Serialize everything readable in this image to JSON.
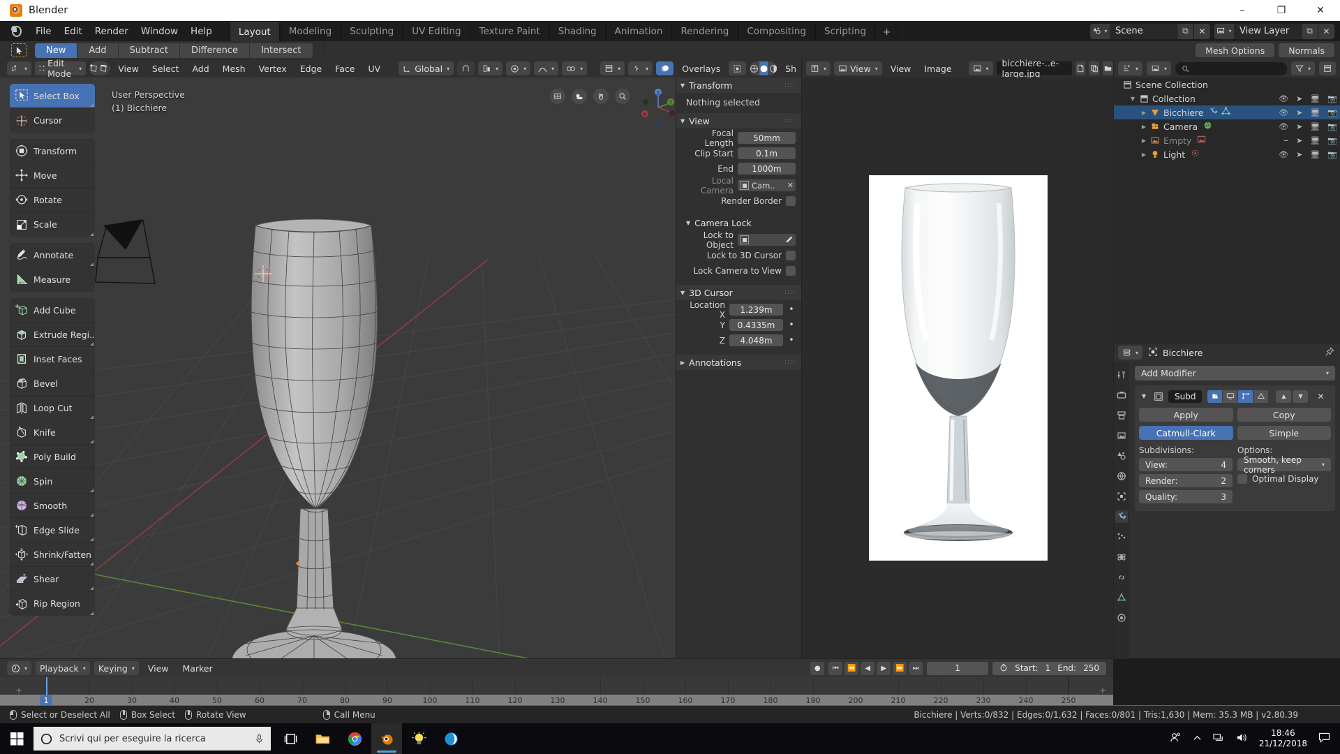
{
  "window": {
    "title": "Blender",
    "controls": {
      "minimize": "–",
      "maximize": "❐",
      "close": "✕"
    }
  },
  "topbar": {
    "menus": [
      "File",
      "Edit",
      "Render",
      "Window",
      "Help"
    ],
    "workspaces": [
      {
        "label": "Layout",
        "active": true
      },
      {
        "label": "Modeling",
        "active": false
      },
      {
        "label": "Sculpting",
        "active": false
      },
      {
        "label": "UV Editing",
        "active": false
      },
      {
        "label": "Texture Paint",
        "active": false
      },
      {
        "label": "Shading",
        "active": false
      },
      {
        "label": "Animation",
        "active": false
      },
      {
        "label": "Rendering",
        "active": false
      },
      {
        "label": "Compositing",
        "active": false
      },
      {
        "label": "Scripting",
        "active": false
      }
    ],
    "add_workspace": "+",
    "scene": {
      "name": "Scene",
      "new_btn": "⧉",
      "unlink_btn": "✕"
    },
    "view_layer": {
      "name": "View Layer",
      "new_btn": "⧉",
      "unlink_btn": "✕"
    }
  },
  "tool_settings": {
    "boolean_modes": [
      {
        "label": "New",
        "active": true
      },
      {
        "label": "Add",
        "active": false
      },
      {
        "label": "Subtract",
        "active": false
      },
      {
        "label": "Difference",
        "active": false
      },
      {
        "label": "Intersect",
        "active": false
      }
    ],
    "right_group": [
      "Mesh Options",
      "Normals"
    ]
  },
  "viewport_header": {
    "mode": "Edit Mode",
    "select_modes": [
      "vertex",
      "edge",
      "face"
    ],
    "active_select_mode": "face",
    "menus": [
      "View",
      "Select",
      "Add",
      "Mesh",
      "Vertex",
      "Edge",
      "Face",
      "UV"
    ],
    "transform_orientation": "Global",
    "overlays_label": "Overlays",
    "shading_label": "Sh",
    "shading_modes": [
      "wireframe",
      "solid",
      "material",
      "rendered"
    ],
    "active_shading": "solid"
  },
  "viewport": {
    "perspective_line1": "User Perspective",
    "perspective_line2": "(1) Bicchiere",
    "tool_groups": [
      [
        {
          "label": "Select Box",
          "icon": "select-box-icon",
          "active": true,
          "has_corner": true
        },
        {
          "label": "Cursor",
          "icon": "cursor-icon",
          "active": false,
          "has_corner": false
        }
      ],
      [
        {
          "label": "Transform",
          "icon": "transform-icon",
          "active": false,
          "has_corner": false
        },
        {
          "label": "Move",
          "icon": "move-icon",
          "active": false,
          "has_corner": false
        },
        {
          "label": "Rotate",
          "icon": "rotate-icon",
          "active": false,
          "has_corner": false
        },
        {
          "label": "Scale",
          "icon": "scale-icon",
          "active": false,
          "has_corner": true
        }
      ],
      [
        {
          "label": "Annotate",
          "icon": "annotate-icon",
          "active": false,
          "has_corner": true
        },
        {
          "label": "Measure",
          "icon": "measure-icon",
          "active": false,
          "has_corner": false
        }
      ],
      [
        {
          "label": "Add Cube",
          "icon": "add-cube-icon",
          "active": false,
          "has_corner": false
        },
        {
          "label": "Extrude Regi..",
          "icon": "extrude-icon",
          "active": false,
          "has_corner": true
        },
        {
          "label": "Inset Faces",
          "icon": "inset-faces-icon",
          "active": false,
          "has_corner": false
        },
        {
          "label": "Bevel",
          "icon": "bevel-icon",
          "active": false,
          "has_corner": false
        },
        {
          "label": "Loop Cut",
          "icon": "loop-cut-icon",
          "active": false,
          "has_corner": true
        },
        {
          "label": "Knife",
          "icon": "knife-icon",
          "active": false,
          "has_corner": true
        },
        {
          "label": "Poly Build",
          "icon": "poly-build-icon",
          "active": false,
          "has_corner": false
        },
        {
          "label": "Spin",
          "icon": "spin-icon",
          "active": false,
          "has_corner": true
        },
        {
          "label": "Smooth",
          "icon": "smooth-icon",
          "active": false,
          "has_corner": true
        },
        {
          "label": "Edge Slide",
          "icon": "edge-slide-icon",
          "active": false,
          "has_corner": true
        },
        {
          "label": "Shrink/Fatten",
          "icon": "shrink-fatten-icon",
          "active": false,
          "has_corner": true
        },
        {
          "label": "Shear",
          "icon": "shear-icon",
          "active": false,
          "has_corner": true
        },
        {
          "label": "Rip Region",
          "icon": "rip-region-icon",
          "active": false,
          "has_corner": true
        }
      ]
    ]
  },
  "sidebar_n": {
    "transform": {
      "title": "Transform",
      "empty_text": "Nothing selected"
    },
    "view": {
      "title": "View",
      "focal_length_label": "Focal Length",
      "focal_length_value": "50mm",
      "clip_start_label": "Clip Start",
      "clip_start_value": "0.1m",
      "clip_end_label": "End",
      "clip_end_value": "1000m",
      "local_camera_label": "Local Camera",
      "local_camera_value": "Cam..",
      "render_border_label": "Render Border"
    },
    "camera_lock": {
      "title": "Camera Lock",
      "lock_to_object_label": "Lock to Object",
      "lock_to_3d_cursor_label": "Lock to 3D Cursor",
      "lock_camera_to_view_label": "Lock Camera to View"
    },
    "cursor_3d": {
      "title": "3D Cursor",
      "location_x_label": "Location X",
      "location_x_value": "1.239m",
      "location_y_label": "Y",
      "location_y_value": "0.4335m",
      "location_z_label": "Z",
      "location_z_value": "4.048m"
    },
    "annotations": {
      "title": "Annotations"
    }
  },
  "image_editor": {
    "editor_type": "image-editor-icon",
    "mode": "View",
    "menus": [
      "View",
      "Image"
    ],
    "image_name": "bicchiere-..e-large.jpg",
    "buttons": [
      "new-image",
      "copy-image",
      "open-image"
    ]
  },
  "outliner": {
    "display_mode": "View Layer",
    "search_placeholder": "",
    "filter_icon": "filter-icon",
    "rows": [
      {
        "label": "Scene Collection",
        "icon": "collection-icon",
        "depth": 0,
        "selected": false,
        "dim": false,
        "expand": "",
        "badges": [],
        "show_cols": false
      },
      {
        "label": "Collection",
        "icon": "collection-icon",
        "depth": 1,
        "selected": false,
        "dim": false,
        "expand": "▼",
        "badges": [],
        "show_cols": true
      },
      {
        "label": "Bicchiere",
        "icon": "mesh-object-icon",
        "depth": 2,
        "selected": true,
        "dim": false,
        "expand": "▶",
        "badges": [
          "modifier-icon",
          "mesh-data-icon"
        ],
        "show_cols": true
      },
      {
        "label": "Camera",
        "icon": "camera-object-icon",
        "depth": 2,
        "selected": false,
        "dim": false,
        "expand": "▶",
        "badges": [
          "camera-data-icon"
        ],
        "show_cols": true
      },
      {
        "label": "Empty",
        "icon": "empty-image-icon",
        "depth": 2,
        "selected": false,
        "dim": true,
        "expand": "▶",
        "badges": [
          "image-data-icon"
        ],
        "show_cols": true
      },
      {
        "label": "Light",
        "icon": "light-object-icon",
        "depth": 2,
        "selected": false,
        "dim": false,
        "expand": "▶",
        "badges": [
          "light-data-icon"
        ],
        "show_cols": true
      }
    ],
    "column_icons": [
      "eye-icon",
      "cursor-arrow-icon",
      "monitor-icon",
      "camera-icon"
    ]
  },
  "properties": {
    "object_name": "Bicchiere",
    "pin_icon": "pin-icon",
    "tabs": [
      "tool-tab",
      "render-tab",
      "output-tab",
      "view-layer-tab",
      "scene-tab",
      "world-tab",
      "object-tab",
      "modifier-tab",
      "particles-tab",
      "physics-tab",
      "constraints-tab",
      "data-tab",
      "material-tab"
    ],
    "active_tab_index": 7,
    "add_modifier": "Add Modifier",
    "modifier": {
      "name": "Subd",
      "icon": "subsurf-icon",
      "display_toggles": [
        "render-toggle",
        "realtime-toggle",
        "edit-mode-toggle",
        "on-cage-toggle"
      ],
      "active_toggles": [
        0,
        2
      ],
      "move_up": "▲",
      "move_down": "▼",
      "remove": "✕",
      "apply_label": "Apply",
      "copy_label": "Copy",
      "algorithm_options": [
        {
          "label": "Catmull-Clark",
          "active": true
        },
        {
          "label": "Simple",
          "active": false
        }
      ],
      "subdivisions_label": "Subdivisions:",
      "options_label": "Options:",
      "view_label": "View:",
      "view_value": "4",
      "render_label": "Render:",
      "render_value": "2",
      "quality_label": "Quality:",
      "quality_value": "3",
      "uv_smooth_value": "Smooth, keep corners",
      "optimal_display_label": "Optimal Display"
    }
  },
  "timeline": {
    "editor_icon": "timeline-icon",
    "menus": [
      "Playback",
      "Keying",
      "View",
      "Marker"
    ],
    "playback_buttons": [
      "record",
      "jump-start",
      "rewind",
      "play-reverse",
      "play",
      "fast-forward",
      "jump-end"
    ],
    "current_frame": "1",
    "start_label": "Start:",
    "start_value": "1",
    "end_label": "End:",
    "end_value": "250",
    "ticks": [
      10,
      20,
      30,
      40,
      50,
      60,
      70,
      80,
      90,
      100,
      110,
      120,
      130,
      140,
      150,
      160,
      170,
      180,
      190,
      200,
      210,
      220,
      230,
      240,
      250
    ],
    "playhead_frame": 1
  },
  "statusbar": {
    "hints": [
      {
        "mouse": "l",
        "label": "Select or Deselect All"
      },
      {
        "mouse": "m",
        "label": "Box Select"
      },
      {
        "mouse": "m",
        "label": "Rotate View"
      },
      {
        "mouse": "r",
        "label": "Call Menu"
      }
    ],
    "stats": "Bicchiere | Verts:0/832 | Edges:0/1,632 | Faces:0/801 | Tris:1,630 | Mem: 35.3 MB | v2.80.39"
  },
  "taskbar": {
    "search_placeholder": "Scrivi qui per eseguire la ricerca",
    "mic_icon": "microphone-icon",
    "apps": [
      "task-view-icon",
      "file-explorer-icon",
      "chrome-icon",
      "blender-icon",
      "blender-alt-icon",
      "browser-icon"
    ],
    "active_app_index": 3,
    "tray": [
      "people-icon",
      "show-hidden-icon",
      "network-icon",
      "volume-icon"
    ],
    "time": "18:46",
    "date": "21/12/2018",
    "notification_icon": "notification-icon"
  },
  "colors": {
    "accent": "#4772b3",
    "orange": "#e87d0d",
    "panel": "#303030",
    "viewport_bg": "#3b3b3b"
  }
}
